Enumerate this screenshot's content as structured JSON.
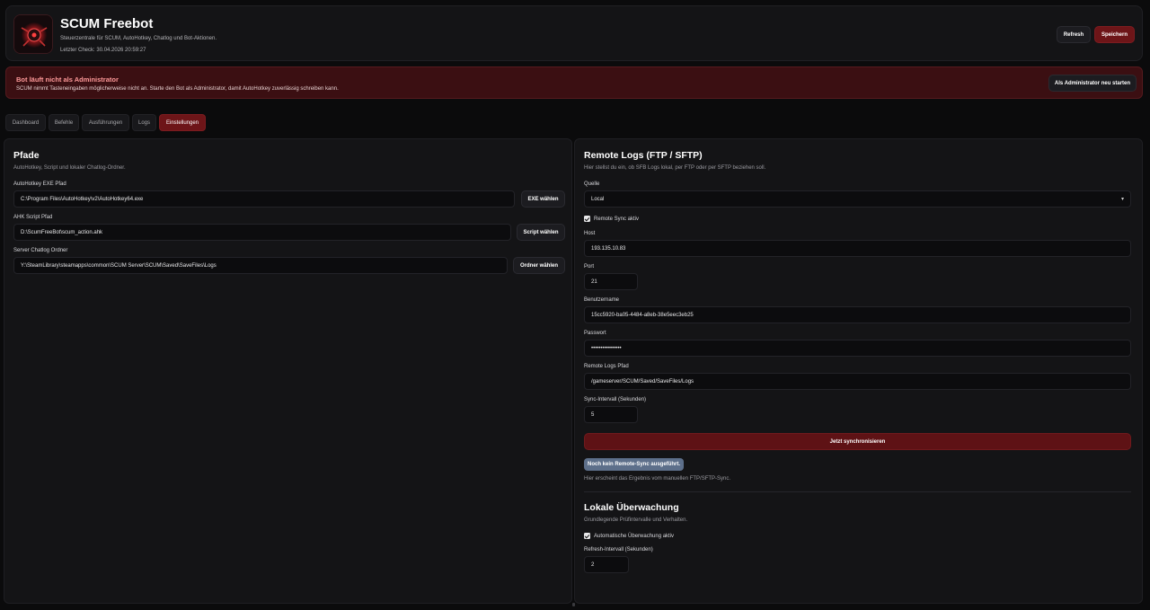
{
  "header": {
    "title": "SCUM Freebot",
    "subtitle": "Steuerzentrale für SCUM, AutoHotkey, Chatlog und Bot-Aktionen.",
    "last_check": "Letzter Check: 30.04.2026 20:59:27",
    "refresh_label": "Refresh",
    "save_label": "Speichern"
  },
  "alert": {
    "title": "Bot läuft nicht als Administrator",
    "text": "SCUM nimmt Tasteneingaben möglicherweise nicht an. Starte den Bot als Administrator, damit AutoHotkey zuverlässig schreiben kann.",
    "button_label": "Als Administrator neu starten"
  },
  "tabs": [
    {
      "label": "Dashboard"
    },
    {
      "label": "Befehle"
    },
    {
      "label": "Ausführungen"
    },
    {
      "label": "Logs"
    },
    {
      "label": "Einstellungen"
    }
  ],
  "paths": {
    "title": "Pfade",
    "description": "AutoHotkey, Script und lokaler Chatlog-Ordner.",
    "ahk_exe": {
      "label": "AutoHotkey EXE Pfad",
      "value": "C:\\Program Files\\AutoHotkey\\v2\\AutoHotkey64.exe",
      "button": "EXE wählen"
    },
    "ahk_script": {
      "label": "AHK Script Pfad",
      "value": "D:\\ScumFreeBot\\scum_action.ahk",
      "button": "Script wählen"
    },
    "chatlog": {
      "label": "Server Chatlog Ordner",
      "value": "Y:\\SteamLibrary\\steamapps\\common\\SCUM Server\\SCUM\\Saved\\SaveFiles\\Logs",
      "button": "Ordner wählen"
    }
  },
  "remote": {
    "title": "Remote Logs (FTP / SFTP)",
    "description": "Hier stellst du ein, ob SFB Logs lokal, per FTP oder per SFTP beziehen soll.",
    "source": {
      "label": "Quelle",
      "value": "Local"
    },
    "sync_enabled_label": "Remote Sync aktiv",
    "host": {
      "label": "Host",
      "value": "193.135.10.83"
    },
    "port": {
      "label": "Port",
      "value": "21"
    },
    "username": {
      "label": "Benutzername",
      "value": "15cc5920-ba05-4484-a8eb-38e5eec3eb25"
    },
    "password": {
      "label": "Passwort",
      "value": "••••••••••••••••"
    },
    "remote_path": {
      "label": "Remote Logs Pfad",
      "value": "/gameserver/SCUM/Saved/SaveFiles/Logs"
    },
    "interval": {
      "label": "Sync-Intervall (Sekunden)",
      "value": "5"
    },
    "sync_button": "Jetzt synchronisieren",
    "status_badge": "Noch kein Remote-Sync ausgeführt.",
    "status_hint": "Hier erscheint das Ergebnis vom manuellen FTP/SFTP-Sync."
  },
  "local": {
    "title": "Lokale Überwachung",
    "description": "Grundlegende Prüfintervalle und Verhalten.",
    "auto_label": "Automatische Überwachung aktiv",
    "refresh": {
      "label": "Refresh-Intervall (Sekunden)",
      "value": "2"
    }
  },
  "colors": {
    "accent": "#6d1518",
    "background": "#0b0b0c",
    "alert_bg": "#3b0f12",
    "badge": "#5d6f8a"
  }
}
